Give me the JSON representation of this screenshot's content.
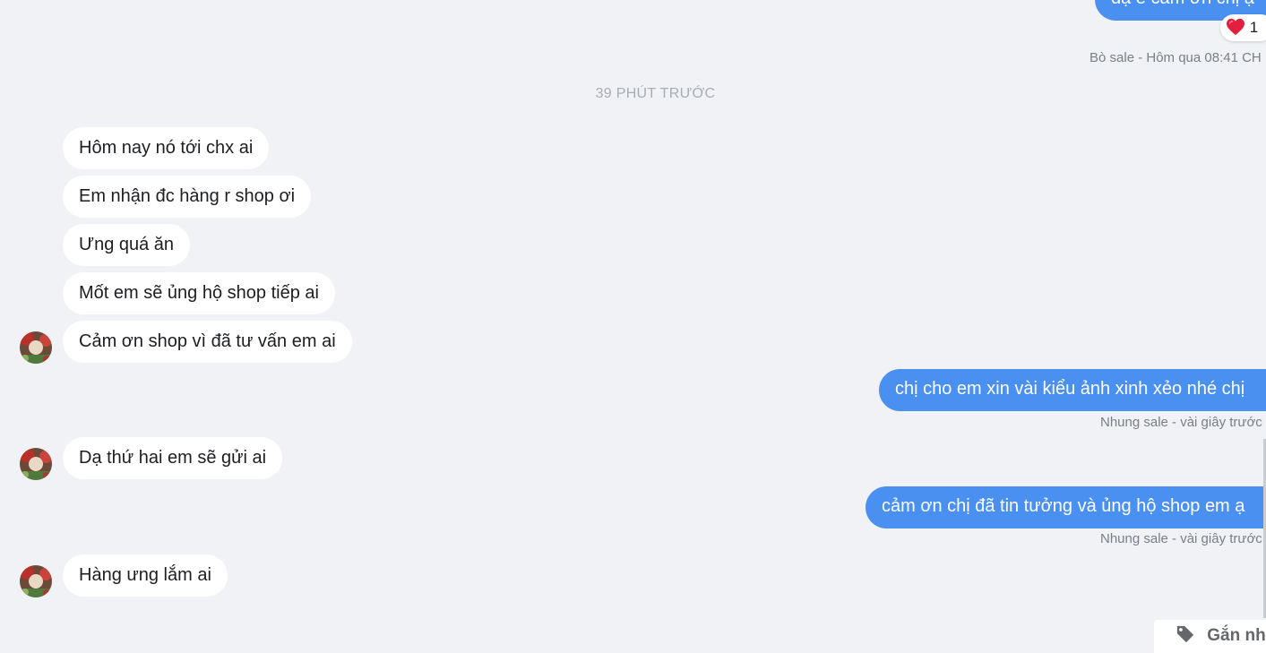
{
  "top_message": {
    "text": "dạ e cảm ơn chị ạ",
    "reaction_count": "1",
    "reaction_icon": "heart-icon",
    "meta": "Bò sale - Hôm qua 08:41 CH"
  },
  "divider": {
    "label": "39 PHÚT TRƯỚC"
  },
  "incoming_group_1": [
    "Hôm nay nó tới chx ai",
    "Em nhận đc hàng r shop ơi",
    "Ưng quá ăn",
    "Mốt em sẽ ủng hộ shop tiếp ai",
    "Cảm ơn shop vì đã tư vấn em ai"
  ],
  "outgoing_1": {
    "text": "chị cho em xin vài kiểu ảnh xinh xẻo nhé chị",
    "meta": "Nhung sale - vài giây trước"
  },
  "incoming_2": {
    "text": "Dạ thứ hai em sẽ gửi ai"
  },
  "outgoing_2": {
    "text": "cảm ơn chị đã tin tưởng và ủng hộ shop em ạ",
    "meta": "Nhung sale - vài giây trước"
  },
  "incoming_3": {
    "text": "Hàng ưng lắm ai"
  },
  "tag_button": {
    "label": "Gắn nhãn",
    "icon": "tag-icon"
  },
  "colors": {
    "background": "#f0f2f5",
    "outgoing_bubble": "#4a90f0",
    "incoming_bubble": "#ffffff",
    "meta_text": "#7a7f87"
  }
}
